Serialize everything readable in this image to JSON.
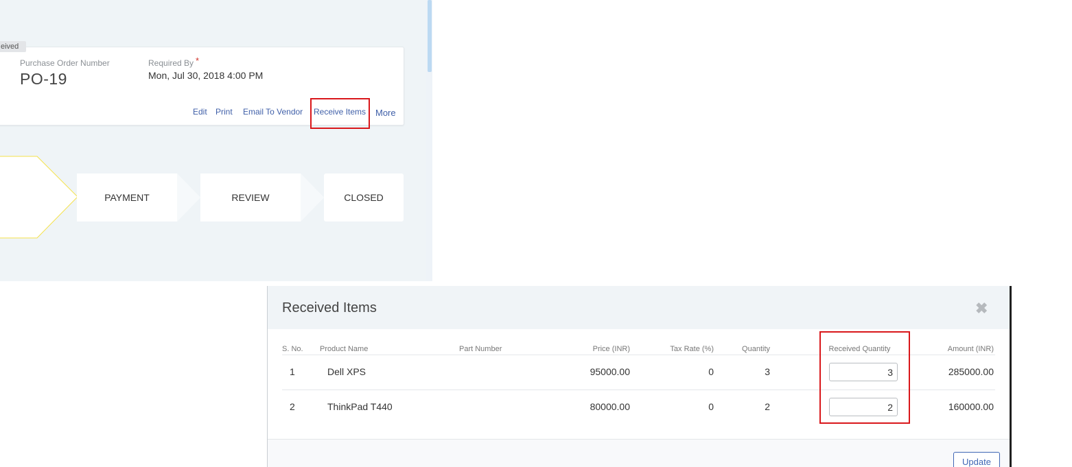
{
  "order": {
    "status_chip": "eived",
    "po_label": "Purchase Order Number",
    "po_value": "PO-19",
    "required_by_label": "Required By",
    "required_by_star": "*",
    "required_by_value": "Mon, Jul 30, 2018 4:00 PM",
    "actions": {
      "edit": "Edit",
      "print": "Print",
      "email_vendor": "Email To Vendor",
      "receive_items": "Receive Items",
      "more": "More"
    }
  },
  "workflow": {
    "steps": [
      "PAYMENT",
      "REVIEW",
      "CLOSED"
    ],
    "colors": {
      "active_border": "#f5e24a",
      "step_bg": "#ffffff"
    }
  },
  "modal": {
    "title": "Received Items",
    "close_icon": "close-icon",
    "columns": {
      "sno": "S. No.",
      "product": "Product Name",
      "part": "Part Number",
      "price": "Price (INR)",
      "tax": "Tax Rate (%)",
      "qty": "Quantity",
      "received": "Received Quantity",
      "amount": "Amount (INR)"
    },
    "rows": [
      {
        "sno": "1",
        "product": "Dell XPS",
        "part": "",
        "price": "95000.00",
        "tax": "0",
        "qty": "3",
        "received": "3",
        "amount": "285000.00"
      },
      {
        "sno": "2",
        "product": "ThinkPad T440",
        "part": "",
        "price": "80000.00",
        "tax": "0",
        "qty": "2",
        "received": "2",
        "amount": "160000.00"
      }
    ],
    "update_label": "Update"
  },
  "colors": {
    "highlight": "#d9161a",
    "link": "#3f5fa8",
    "panel_bg": "#eff4f7"
  }
}
